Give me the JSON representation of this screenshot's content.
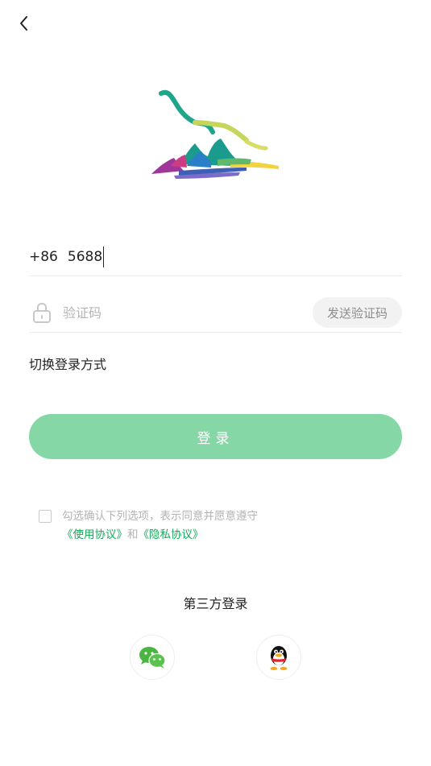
{
  "nav": {
    "back_icon": "chevron-left-icon"
  },
  "logo": {
    "name": "colorful-mountain-logo"
  },
  "phone": {
    "country_code": "+86",
    "value": "5688"
  },
  "code": {
    "icon": "lock-icon",
    "placeholder": "验证码",
    "send_label": "发送验证码"
  },
  "switch_login_label": "切换登录方式",
  "login_label": "登录",
  "agreement": {
    "text": "勾选确认下列选项，表示同意并愿意遵守",
    "terms_link": "《使用协议》",
    "and": "和",
    "privacy_link": "《隐私协议》"
  },
  "third_party": {
    "title": "第三方登录",
    "providers": [
      {
        "name": "wechat",
        "icon": "wechat-icon"
      },
      {
        "name": "qq",
        "icon": "qq-icon"
      }
    ]
  },
  "colors": {
    "accent": "#86d7a6",
    "link": "#1aa85a",
    "placeholder": "#b5b5b5"
  }
}
